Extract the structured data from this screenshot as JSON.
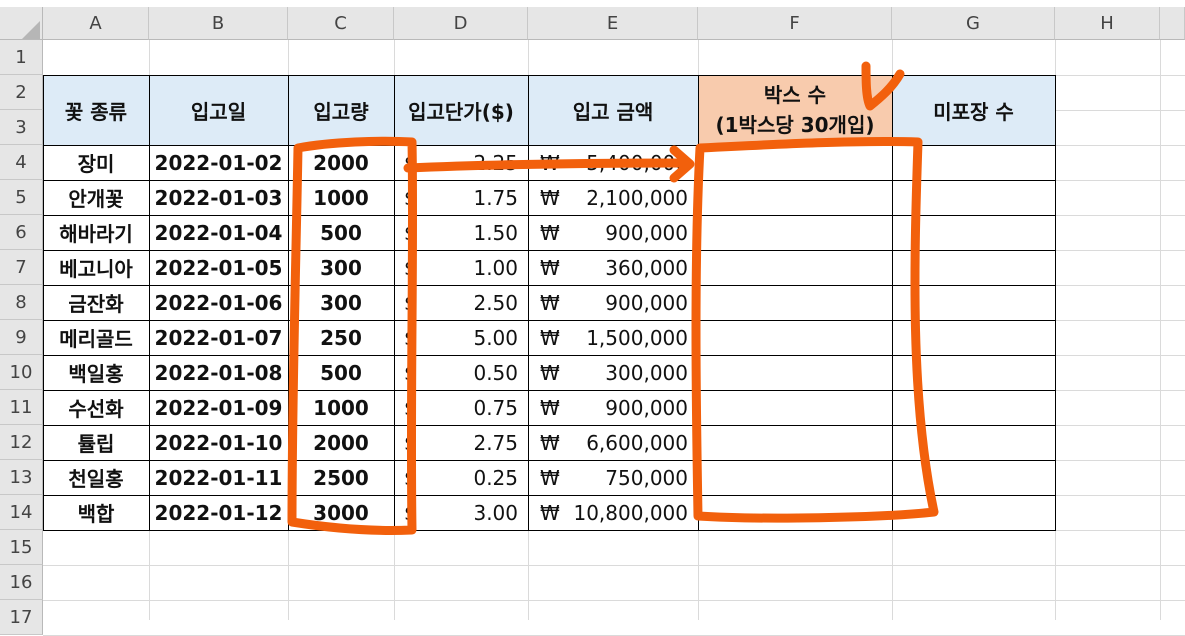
{
  "columns": [
    "A",
    "B",
    "C",
    "D",
    "E",
    "F",
    "G",
    "H"
  ],
  "rows": [
    "1",
    "2",
    "3",
    "4",
    "5",
    "6",
    "7",
    "8",
    "9",
    "10",
    "11",
    "12",
    "13",
    "14",
    "15",
    "16",
    "17"
  ],
  "headers": {
    "flower_type": "꽃 종류",
    "in_date": "입고일",
    "in_qty": "입고량",
    "unit_price": "입고단가($)",
    "in_amount": "입고 금액",
    "box_count_line1": "박스 수",
    "box_count_line2": "(1박스당 30개입)",
    "unpacked": "미포장 수"
  },
  "currency": {
    "dollar": "$",
    "won": "₩"
  },
  "records": [
    {
      "name": "장미",
      "date": "2022-01-02",
      "qty": "2000",
      "price": "2.25",
      "amount": "5,400,000"
    },
    {
      "name": "안개꽃",
      "date": "2022-01-03",
      "qty": "1000",
      "price": "1.75",
      "amount": "2,100,000"
    },
    {
      "name": "해바라기",
      "date": "2022-01-04",
      "qty": "500",
      "price": "1.50",
      "amount": "900,000"
    },
    {
      "name": "베고니아",
      "date": "2022-01-05",
      "qty": "300",
      "price": "1.00",
      "amount": "360,000"
    },
    {
      "name": "금잔화",
      "date": "2022-01-06",
      "qty": "300",
      "price": "2.50",
      "amount": "900,000"
    },
    {
      "name": "메리골드",
      "date": "2022-01-07",
      "qty": "250",
      "price": "5.00",
      "amount": "1,500,000"
    },
    {
      "name": "백일홍",
      "date": "2022-01-08",
      "qty": "500",
      "price": "0.50",
      "amount": "300,000"
    },
    {
      "name": "수선화",
      "date": "2022-01-09",
      "qty": "1000",
      "price": "0.75",
      "amount": "900,000"
    },
    {
      "name": "튤립",
      "date": "2022-01-10",
      "qty": "2000",
      "price": "2.75",
      "amount": "6,600,000"
    },
    {
      "name": "천일홍",
      "date": "2022-01-11",
      "qty": "2500",
      "price": "0.25",
      "amount": "750,000"
    },
    {
      "name": "백합",
      "date": "2022-01-12",
      "qty": "3000",
      "price": "3.00",
      "amount": "10,800,000"
    }
  ],
  "colors": {
    "header_blue": "#ddebf7",
    "header_orange": "#f8cbad",
    "annotation": "#f2600c"
  }
}
